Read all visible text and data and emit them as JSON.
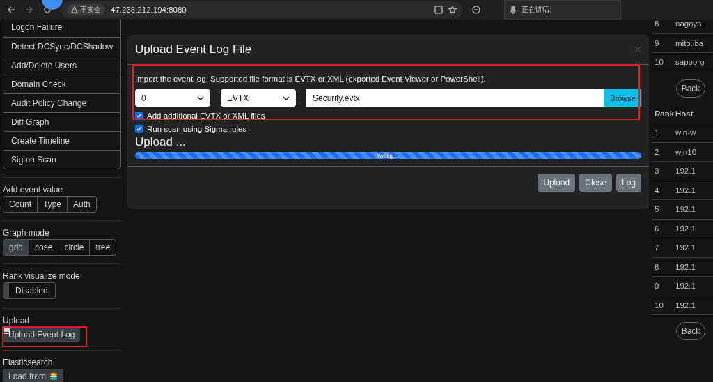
{
  "browser": {
    "security_badge": "不安全",
    "url": "47.238.212.194:8080",
    "voice_panel": "正在讲话:"
  },
  "sidebar": {
    "menu_items": [
      "Logon Failure",
      "Detect DCSync/DCShadow",
      "Add/Delete Users",
      "Domain Check",
      "Audit Policy Change",
      "Diff Graph",
      "Create Timeline",
      "Sigma Scan"
    ],
    "groups": [
      {
        "label": "Add event value",
        "kind": "buttons",
        "options": [
          {
            "label": "Count",
            "selected": false
          },
          {
            "label": "Type",
            "selected": false
          },
          {
            "label": "Auth",
            "selected": false
          }
        ]
      },
      {
        "label": "Graph mode",
        "kind": "buttons",
        "options": [
          {
            "label": "grid",
            "selected": true
          },
          {
            "label": "cose",
            "selected": false
          },
          {
            "label": "circle",
            "selected": false
          },
          {
            "label": "tree",
            "selected": false
          }
        ]
      },
      {
        "label": "Rank visualize mode",
        "kind": "toggle",
        "toggle": {
          "label": "Disabled",
          "on": false
        }
      },
      {
        "label": "Upload",
        "kind": "button",
        "button": "Upload Event Log",
        "highlighted": true
      },
      {
        "label": "Elasticsearch",
        "kind": "button",
        "button": "Load from"
      }
    ]
  },
  "modal": {
    "title": "Upload Event Log File",
    "description": "Import the event log. Supported file format is EVTX or XML (exported Event Viewer or PowerShell).",
    "selects": [
      "0",
      "EVTX"
    ],
    "file": "Security.evtx",
    "browse": "Browse",
    "checkboxes": [
      {
        "label": "Add additional EVTX or XML files",
        "checked": true
      },
      {
        "label": "Run scan using Sigma rules",
        "checked": true
      }
    ],
    "status": "Upload ...",
    "progress": {
      "level": 1,
      "label": "Waiting ..."
    },
    "buttons": [
      "Upload",
      "Close",
      "Log"
    ]
  },
  "rank_tables": [
    {
      "rows": [
        {
          "rank": "8",
          "host": "nagoya."
        },
        {
          "rank": "9",
          "host": "mito.iba"
        },
        {
          "rank": "10",
          "host": "sapporo"
        }
      ],
      "back": "Back"
    },
    {
      "columns": [
        "Rank",
        "Host"
      ],
      "rows": [
        {
          "rank": "1",
          "host": "win-w"
        },
        {
          "rank": "2",
          "host": "win10"
        },
        {
          "rank": "3",
          "host": "192.1"
        },
        {
          "rank": "4",
          "host": "192.1"
        },
        {
          "rank": "5",
          "host": "192.1"
        },
        {
          "rank": "6",
          "host": "192.1"
        },
        {
          "rank": "7",
          "host": "192.1"
        },
        {
          "rank": "8",
          "host": "192.1"
        },
        {
          "rank": "9",
          "host": "192.1"
        },
        {
          "rank": "10",
          "host": "192.1"
        }
      ],
      "back": "Back"
    }
  ]
}
